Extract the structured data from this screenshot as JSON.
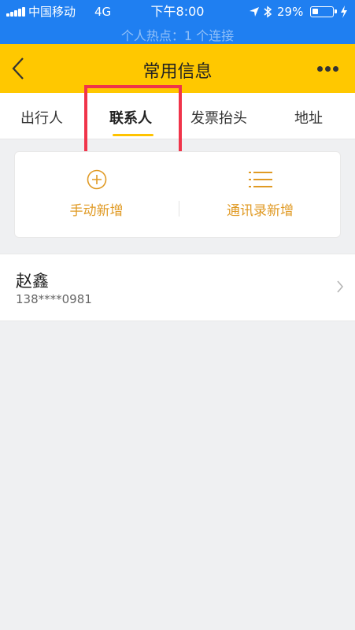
{
  "status_bar": {
    "carrier": "中国移动",
    "network": "4G",
    "time": "下午8:00",
    "battery_percent": "29%",
    "battery_level": 0.29,
    "hotspot_text": "个人热点：1 个连接"
  },
  "nav": {
    "title": "常用信息"
  },
  "tabs": [
    {
      "label": "出行人"
    },
    {
      "label": "联系人"
    },
    {
      "label": "发票抬头"
    },
    {
      "label": "地址"
    }
  ],
  "active_tab": "联系人",
  "actions": {
    "manual_add": "手动新增",
    "contacts_add": "通讯录新增"
  },
  "contacts": [
    {
      "name": "赵鑫",
      "phone": "138****0981"
    }
  ],
  "colors": {
    "status_bar": "#1f7ff1",
    "nav_bar": "#ffc800",
    "accent": "#e09a24",
    "tab_underline": "#ffc300",
    "highlight": "#f0344a"
  }
}
